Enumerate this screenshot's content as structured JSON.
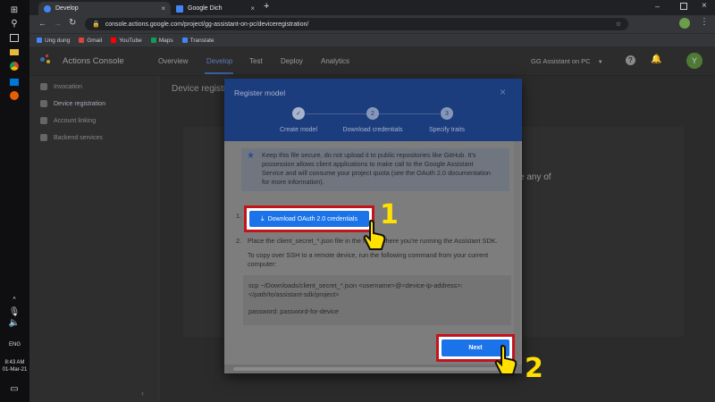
{
  "taskbar": {
    "time": "8:43 AM",
    "date": "01-Mar-21",
    "lang": "ENG"
  },
  "browser": {
    "tabs": [
      {
        "label": "Develop"
      },
      {
        "label": "Google Dich"
      }
    ],
    "url": "console.actions.google.com/project/gg-assistant-on-pc/deviceregistration/",
    "bookmarks": [
      "Ung dung",
      "Gmail",
      "YouTube",
      "Maps",
      "Translate"
    ]
  },
  "app": {
    "title": "Actions Console",
    "nav": [
      "Overview",
      "Develop",
      "Test",
      "Deploy",
      "Analytics"
    ],
    "project": "GG Assistant on PC",
    "avatar": "Y",
    "sidebar": [
      "Invocation",
      "Device registration",
      "Account linking",
      "Backend services"
    ],
    "content_title": "Device registr",
    "content_partial": "e any of"
  },
  "modal": {
    "title": "Register model",
    "steps": [
      {
        "label": "Create model",
        "state": "done"
      },
      {
        "label": "Download credentials",
        "num": "2"
      },
      {
        "label": "Specify traits",
        "num": "3"
      }
    ],
    "info_lines": [
      "Keep this file secure, do not upload it to public repositories like GitHub. It's",
      "possession allows client applications to make call to the Google Assistant",
      "Service and will consume your project quota (see the OAuth 2.0 documentation",
      "for more information)."
    ],
    "step1_num": "1.",
    "download_label": "Download OAuth 2.0 credentials",
    "step2_num": "2.",
    "step2_text": "Place the client_secret_*.json file in the folder where you're running the Assistant SDK.",
    "ssh_lines": [
      "To copy over SSH to a remote device, run the following command from your current",
      "computer:"
    ],
    "code_lines": [
      "scp ~/Downloads/client_secret_*.json <username>@<device-ip-address>:",
      "</path/to/assistant-sdk/project>",
      "password: password-for-device"
    ],
    "next_label": "Next"
  },
  "annotations": {
    "first": "1",
    "second": "2",
    "color": "#ffe000"
  }
}
